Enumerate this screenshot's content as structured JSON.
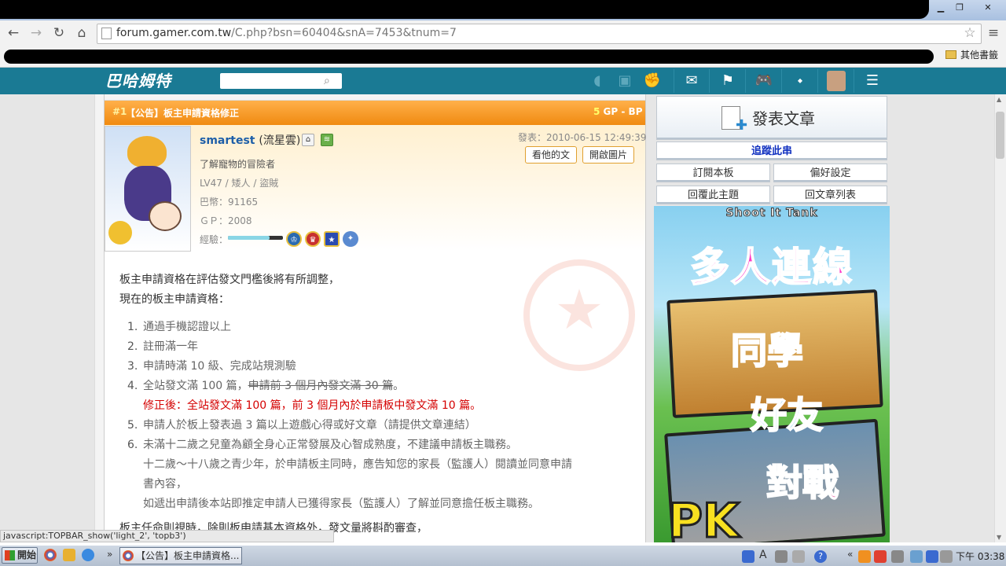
{
  "browser": {
    "url_host": "forum.gamer.com.tw",
    "url_path": "/C.php?bsn=60404&snA=7453&tnum=7",
    "other_bookmarks": "其他書籤",
    "status_text": "javascript:TOPBAR_show('light_2', 'topb3')"
  },
  "site": {
    "logo": "巴哈姆特"
  },
  "post": {
    "number": "#1",
    "title": "【公告】板主申請資格修正",
    "gp_value": "5",
    "gp_label": "GP",
    "bp_label": "- BP",
    "user": {
      "id": "smartest",
      "nickname": "(流星雲)",
      "title": "了解寵物的冒險者",
      "level": "LV47 / 矮人 / 盜賊",
      "coins": "巴幣：91165",
      "gp": "ＧＰ：2008",
      "exp_label": "經驗：",
      "exp_fraction": 0.75
    },
    "date": "發表：2010-06-15 12:49:39",
    "btn_his_posts": "看他的文",
    "btn_open_images": "開啟圖片",
    "body": {
      "line1": "板主申請資格在評估發文門檻後將有所調整，",
      "line2": "現在的板主申請資格：",
      "items": [
        {
          "n": "1.",
          "text": "通過手機認證以上"
        },
        {
          "n": "2.",
          "text": "註冊滿一年"
        },
        {
          "n": "3.",
          "text": "申請時滿 10 級、完成站規測驗"
        }
      ],
      "item4_n": "4.",
      "item4_text": "全站發文滿 100 篇，",
      "item4_strike": "申請前 3 個月內發文滿 30 篇",
      "item4_end": "。",
      "item4_fix": "修正後：全站發文滿 100 篇，前 3 個月內於申請板中發文滿 10 篇。",
      "item5_n": "5.",
      "item5_text": "申請人於板上發表過 3 篇以上遊戲心得或好文章（請提供文章連結）",
      "item6_n": "6.",
      "item6_text": "未滿十二歲之兒童為顧全身心正常發展及心智成熟度，不建議申請板主職務。",
      "item6_sub1": "十二歲～十八歲之青少年，於申請板主同時，應告知您的家長（監護人）閱讀並同意申請",
      "item6_sub2": "書內容，",
      "item6_sub3": "如遞出申請後本站即推定申請人已獲得家長（監護人）了解並同意擔任板主職務。",
      "line_last": "板主任命則視時，除則板申請基本資格外，發文量將斟酌審查，"
    }
  },
  "sidebar": {
    "new_post": "發表文章",
    "track": "追蹤此串",
    "subscribe": "訂閱本板",
    "prefs": "偏好設定",
    "reply": "回覆此主題",
    "back_list": "回文章列表"
  },
  "ad": {
    "title": "Shoot It Tank",
    "headline": "多人連線",
    "word1": "同學",
    "word2": "好友",
    "word3": "對戰",
    "word4": "PK"
  },
  "taskbar": {
    "start": "開始",
    "task_title": "【公告】板主申請資格...",
    "clock": "下午 03:38"
  },
  "colors": {
    "site_bar": "#1a7a94",
    "post_header": "#f08a10",
    "correction_red": "#d40000",
    "track_blue": "#1030c0"
  }
}
